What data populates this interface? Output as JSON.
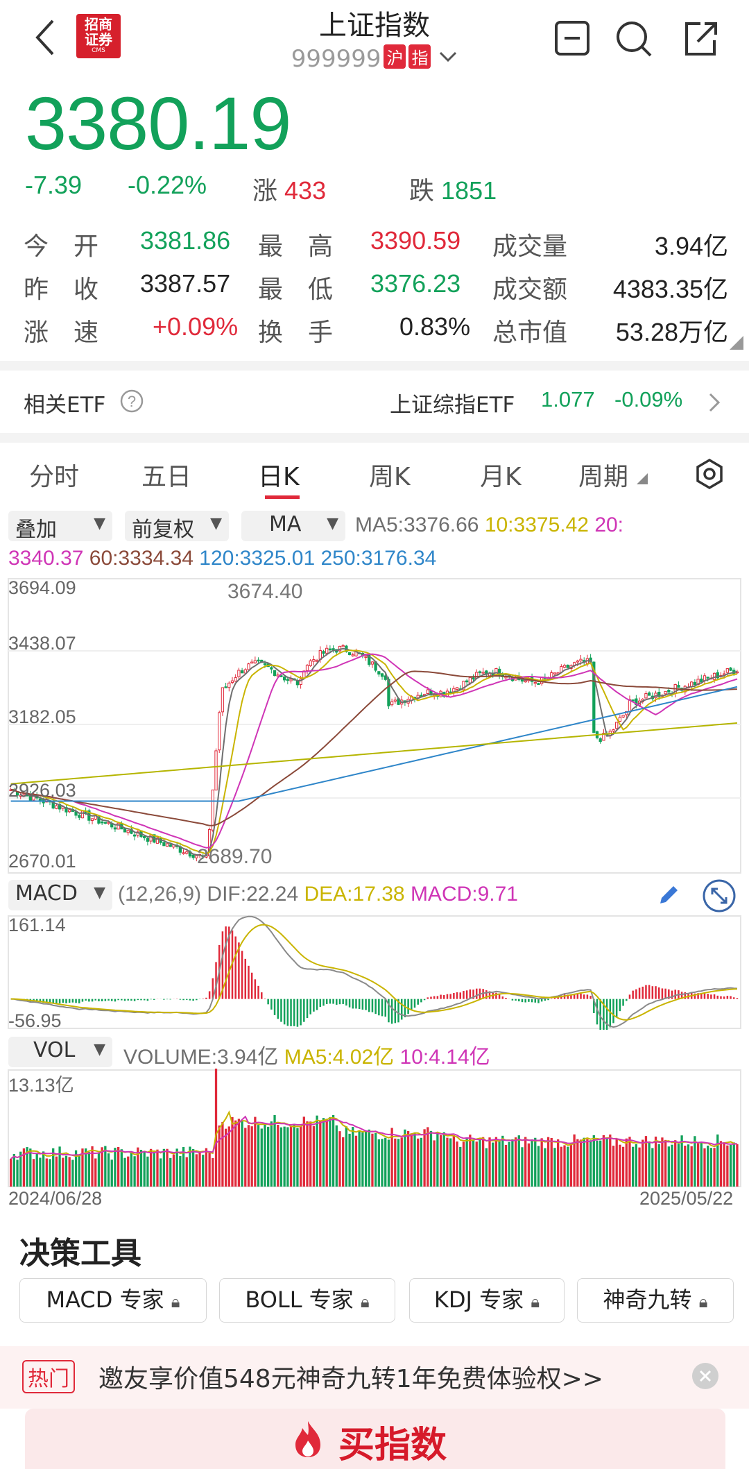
{
  "header": {
    "logo_text": "招商证券",
    "logo_sub": "CMS",
    "title": "上证指数",
    "code": "999999",
    "market_tag": "沪",
    "index_tag": "指"
  },
  "quote": {
    "price": "3380.19",
    "change": "-7.39",
    "change_pct": "-0.22%",
    "up_label": "涨",
    "up_count": "433",
    "down_label": "跌",
    "down_count": "1851"
  },
  "stats": [
    [
      {
        "label": "今　开",
        "value": "3381.86",
        "color": "green"
      },
      {
        "label": "最　高",
        "value": "3390.59",
        "color": "red"
      },
      {
        "label": "成交量",
        "value": "3.94亿",
        "color": "dark"
      }
    ],
    [
      {
        "label": "昨　收",
        "value": "3387.57",
        "color": "dark"
      },
      {
        "label": "最　低",
        "value": "3376.23",
        "color": "green"
      },
      {
        "label": "成交额",
        "value": "4383.35亿",
        "color": "dark"
      }
    ],
    [
      {
        "label": "涨　速",
        "value": "+0.09%",
        "color": "red"
      },
      {
        "label": "换　手",
        "value": "0.83%",
        "color": "dark"
      },
      {
        "label": "总市值",
        "value": "53.28万亿",
        "color": "dark"
      }
    ]
  ],
  "etf": {
    "label": "相关ETF",
    "name": "上证综指ETF",
    "price": "1.077",
    "change": "-0.09%"
  },
  "tabs": [
    "分时",
    "五日",
    "日K",
    "周K",
    "月K",
    "周期"
  ],
  "chart_controls": {
    "overlay": "叠加",
    "adjust": "前复权",
    "indicator": "MA",
    "ma5": "MA5:3376.66",
    "ma10": "10:3375.42",
    "ma20_label": "20:",
    "ma20_value": "3340.37",
    "ma60": "60:3334.34",
    "ma120": "120:3325.01",
    "ma250": "250:3176.34"
  },
  "kline": {
    "y_max": "3694.09",
    "y_mid1": "3438.07",
    "y_mid2": "3182.05",
    "y_mid3": "2926.03",
    "y_min": "2670.01",
    "high_mark": "3674.40",
    "low_mark": "2689.70"
  },
  "macd": {
    "name": "MACD",
    "params": "(12,26,9)",
    "dif": "DIF:22.24",
    "dea": "DEA:17.38",
    "macd": "MACD:9.71",
    "y_max": "161.14",
    "y_min": "-56.95"
  },
  "vol": {
    "name": "VOL",
    "volume": "VOLUME:3.94亿",
    "ma5": "MA5:4.02亿",
    "ma10": "10:4.14亿",
    "y_max": "13.13亿",
    "date_start": "2024/06/28",
    "date_end": "2025/05/22"
  },
  "tools": {
    "title": "决策工具",
    "items": [
      "MACD 专家",
      "BOLL 专家",
      "KDJ 专家",
      "神奇九转"
    ]
  },
  "promo": {
    "tag": "热门",
    "text": "邀友享价值548元神奇九转1年免费体验权>>"
  },
  "buy_label": "买指数",
  "colors": {
    "up": "#e0293a",
    "down": "#12a15a",
    "ma5": "#6f6f6f",
    "ma10": "#c9b400",
    "ma20": "#cf35b6",
    "ma60": "#8b4a3a",
    "ma120": "#2f86c9",
    "ma250": "#b5b500"
  }
}
